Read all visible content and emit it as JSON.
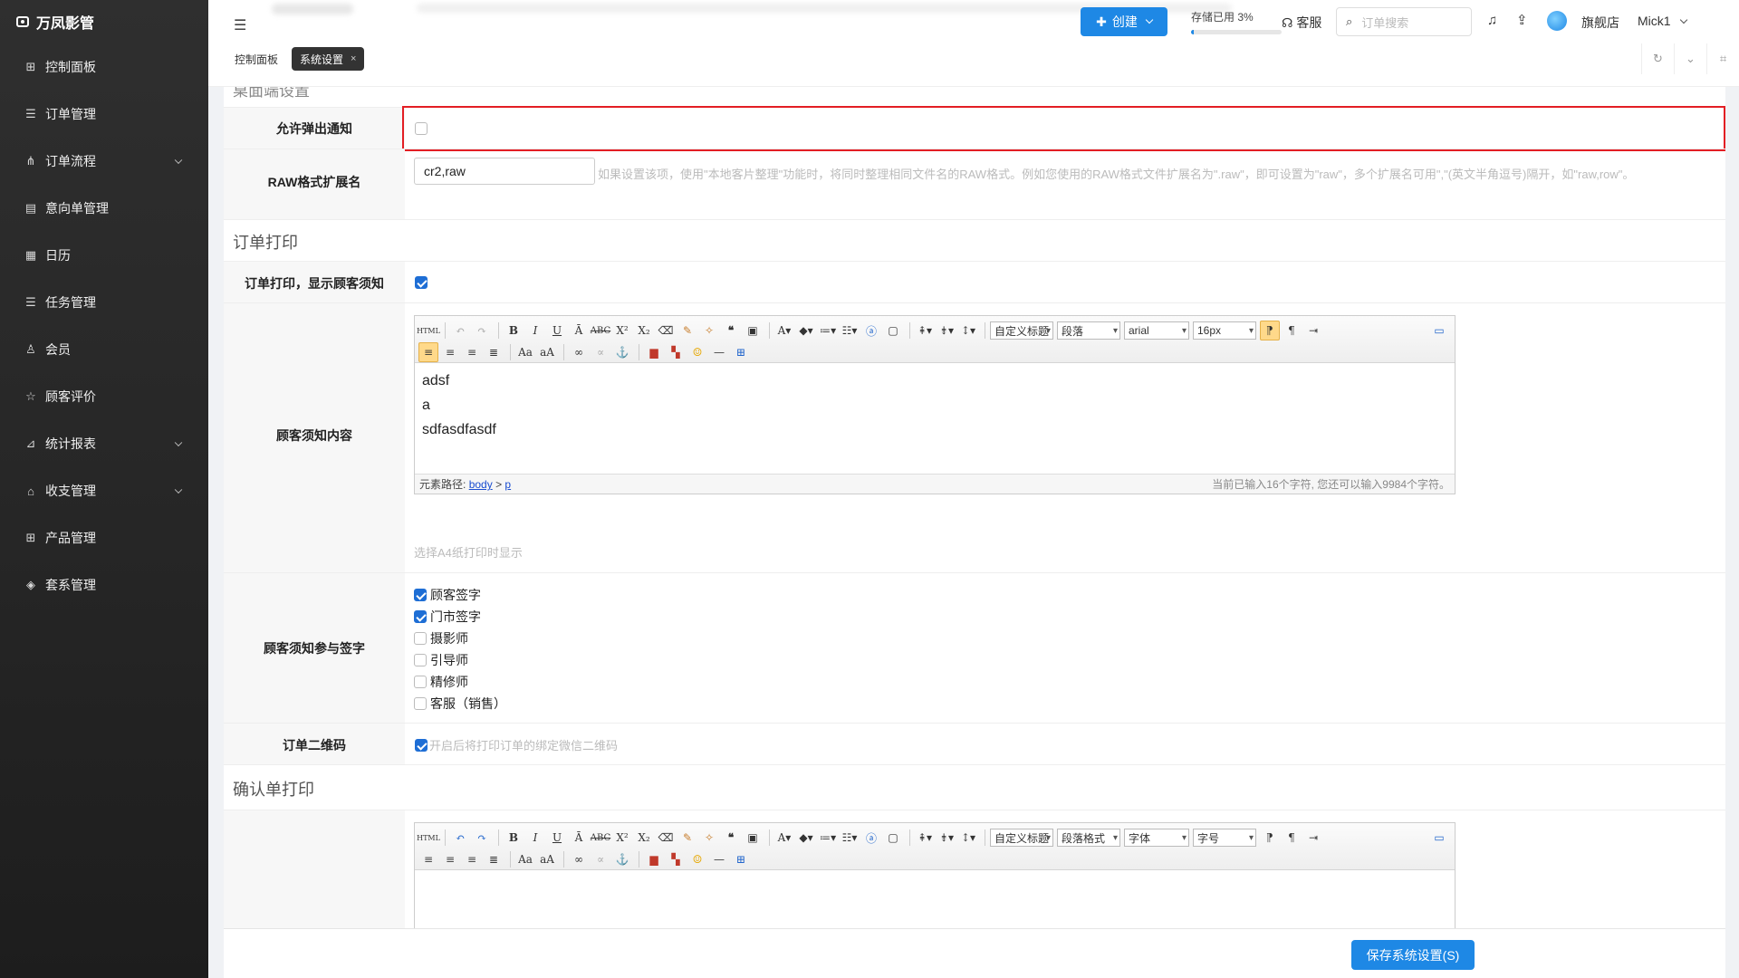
{
  "app": {
    "title": "万凤影管"
  },
  "sidebar": {
    "items": [
      {
        "label": "控制面板",
        "icon": "grid-icon",
        "glyph": "⊞",
        "expandable": false
      },
      {
        "label": "订单管理",
        "icon": "list-icon",
        "glyph": "☰",
        "expandable": false
      },
      {
        "label": "订单流程",
        "icon": "flow-icon",
        "glyph": "⋔",
        "expandable": true
      },
      {
        "label": "意向单管理",
        "icon": "clipboard-icon",
        "glyph": "▤",
        "expandable": false
      },
      {
        "label": "日历",
        "icon": "calendar-icon",
        "glyph": "▦",
        "expandable": false
      },
      {
        "label": "任务管理",
        "icon": "tasks-icon",
        "glyph": "☰",
        "expandable": false
      },
      {
        "label": "会员",
        "icon": "user-icon",
        "glyph": "♙",
        "expandable": false
      },
      {
        "label": "顾客评价",
        "icon": "star-icon",
        "glyph": "☆",
        "expandable": false
      },
      {
        "label": "统计报表",
        "icon": "chart-icon",
        "glyph": "⊿",
        "expandable": true
      },
      {
        "label": "收支管理",
        "icon": "bank-icon",
        "glyph": "⌂",
        "expandable": true
      },
      {
        "label": "产品管理",
        "icon": "products-icon",
        "glyph": "⊞",
        "expandable": false
      },
      {
        "label": "套系管理",
        "icon": "package-icon",
        "glyph": "◈",
        "expandable": false
      }
    ]
  },
  "header": {
    "create_label": "创建",
    "storage_label": "存储已用 3%",
    "storage_pct": 3,
    "service_label": "客服",
    "search_placeholder": "订单搜索",
    "store_name": "旗舰店",
    "username": "Mick1",
    "accent": "#1e88e5"
  },
  "tabs": [
    {
      "label": "控制面板",
      "active": false
    },
    {
      "label": "系统设置",
      "active": true
    }
  ],
  "settings": {
    "partial_section_title": "桌面端设置",
    "popup_label": "允许弹出通知",
    "raw_label": "RAW格式扩展名",
    "raw_value": "cr2,raw",
    "raw_hint": "如果设置该项，使用\"本地客片整理\"功能时，将同时整理相同文件名的RAW格式。例如您使用的RAW格式文件扩展名为\".raw\"，即可设置为\"raw\"，多个扩展名可用\",\"(英文半角逗号)隔开，如\"raw,row\"。",
    "order_print_title": "订单打印",
    "show_notice_label": "订单打印，显示顾客须知",
    "notice_content_label": "顾客须知内容",
    "editor1": {
      "lines": [
        "adsf",
        "a",
        "sdfasdfasdf"
      ],
      "custom_title": "自定义标题",
      "paragraph": "段落",
      "font": "arial",
      "size": "16px",
      "path_label": "元素路径:",
      "path_body": "body",
      "path_sep": ">",
      "path_p": "p",
      "count_text": "当前已输入16个字符, 您还可以输入9984个字符。"
    },
    "a4_hint": "选择A4纸打印时显示",
    "signature_label": "顾客须知参与签字",
    "signatures": [
      {
        "label": "顾客签字",
        "checked": true
      },
      {
        "label": "门市签字",
        "checked": true
      },
      {
        "label": "摄影师",
        "checked": false
      },
      {
        "label": "引导师",
        "checked": false
      },
      {
        "label": "精修师",
        "checked": false
      },
      {
        "label": "客服（销售）",
        "checked": false
      }
    ],
    "qrcode_label": "订单二维码",
    "qrcode_hint": "开启后将打印订单的绑定微信二维码",
    "confirm_print_title": "确认单打印",
    "editor2": {
      "custom_title": "自定义标题",
      "paragraph": "段落格式",
      "font": "字体",
      "size": "字号"
    }
  },
  "footer": {
    "save_label": "保存系统设置(S)"
  },
  "colors": {
    "highlight": "#e31e24",
    "checkbox": "#1e6ed5"
  }
}
